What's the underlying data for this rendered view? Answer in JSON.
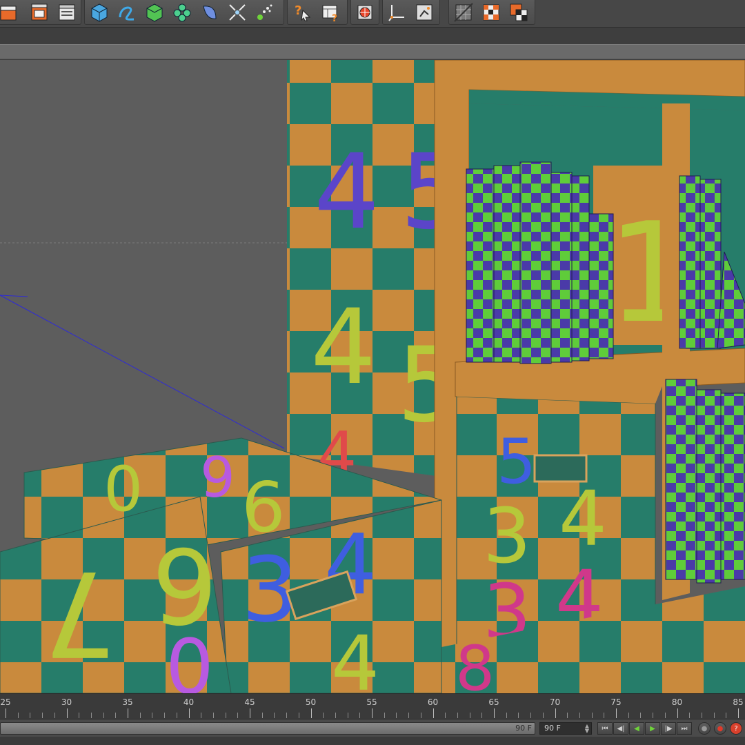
{
  "toolbar": {
    "groups": [
      [
        "render-view-icon",
        "render-picture-viewer-icon",
        "render-settings-icon"
      ],
      [
        "cube-icon",
        "spline-icon",
        "nurbs-icon",
        "mograph-cloner-icon",
        "deformer-icon",
        "scene-environment-icon",
        "particle-emitter-icon"
      ],
      [
        "help-question-icon",
        "info-table-icon"
      ],
      [
        "sphere-light-icon"
      ],
      [
        "axis-workplane-icon",
        "snap-icon"
      ],
      [
        "grid-texture-icon",
        "checker-render-icon",
        "checker-region-icon"
      ]
    ]
  },
  "timeline": {
    "ticks": [
      "25",
      "30",
      "35",
      "40",
      "45",
      "50",
      "55",
      "60",
      "65",
      "70",
      "75",
      "80",
      "85"
    ]
  },
  "controls": {
    "range_end_label": "90 F",
    "current_frame_value": "90 F",
    "buttons": [
      "go-to-start-icon",
      "previous-key-icon",
      "play-backwards-icon",
      "play-forwards-icon",
      "next-key-icon",
      "go-to-end-icon",
      "record-keys-icon",
      "auto-key-icon",
      "keyframe-help-icon"
    ]
  },
  "colors": {
    "teal": "#267d6a",
    "orange": "#c98a3d",
    "purple": "#5b45c9",
    "green": "#6fd33a",
    "viewport_bg": "#5d5d5d",
    "ui_bg": "#3c3c3c"
  }
}
